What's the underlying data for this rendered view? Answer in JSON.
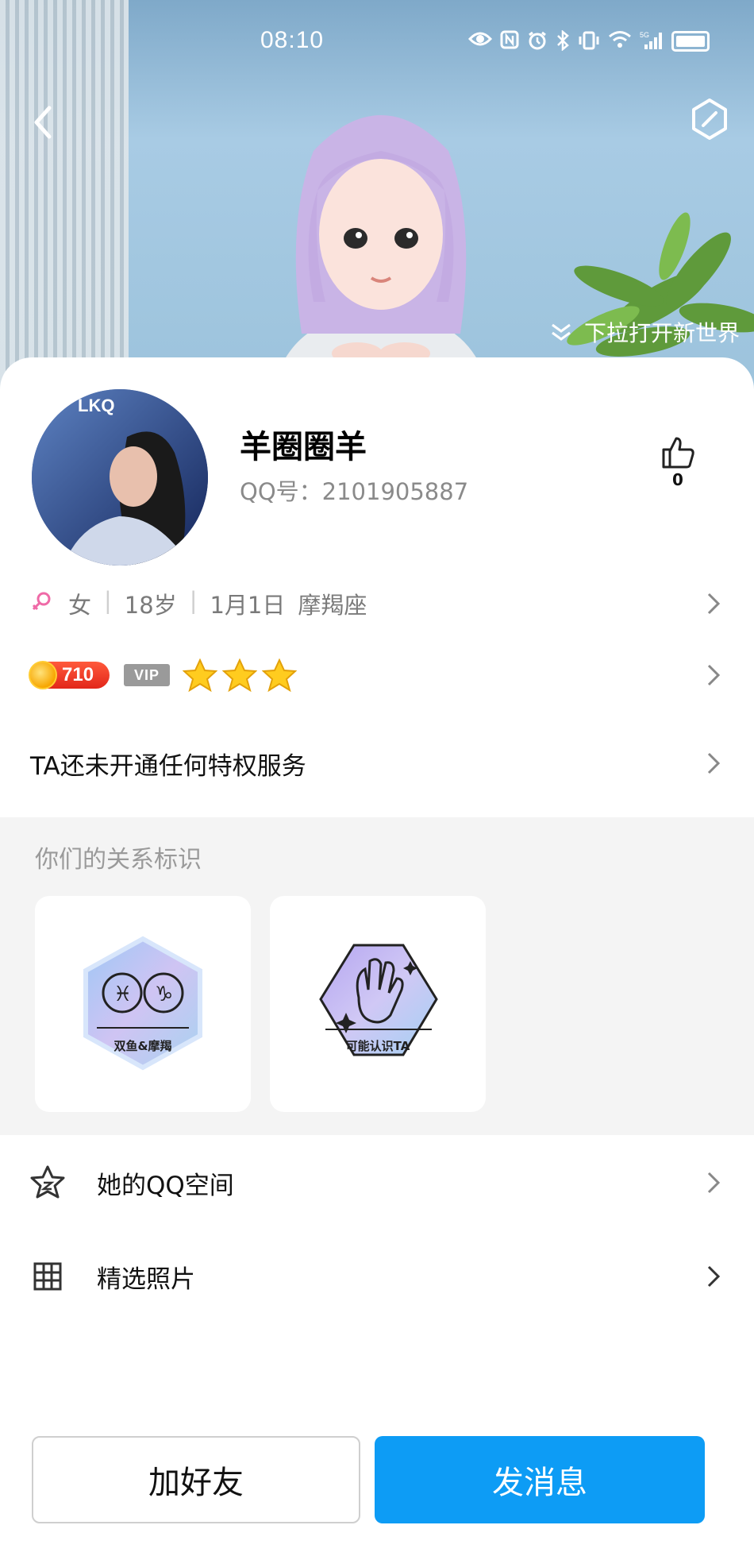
{
  "status_bar": {
    "time": "08:10",
    "icons": [
      "eye-icon",
      "nfc-icon",
      "alarm-icon",
      "bluetooth-icon",
      "vibrate-icon",
      "wifi-icon",
      "signal-5g-icon",
      "battery-icon"
    ]
  },
  "header": {
    "pull_hint": "下拉打开新世界",
    "back_icon": "back-arrow-icon",
    "menu_icon": "hexagon-menu-icon"
  },
  "profile": {
    "name": "羊圈圈羊",
    "qq_label": "QQ号：2101905887",
    "likes": "0",
    "gender": "女",
    "age": "18岁",
    "birthday": "1月1日",
    "zodiac": "摩羯座"
  },
  "badges": {
    "level": "710",
    "vip": "VIP",
    "star_count": 3
  },
  "privilege": "TA还未开通任何特权服务",
  "relation": {
    "title": "你们的关系标识",
    "cards": [
      {
        "label": "双鱼&摩羯"
      },
      {
        "label": "可能认识TA"
      }
    ]
  },
  "menu": [
    {
      "label": "她的QQ空间",
      "icon": "qzone-star-icon"
    },
    {
      "label": "精选照片",
      "icon": "grid-photos-icon"
    }
  ],
  "actions": {
    "add_friend": "加好友",
    "send_message": "发消息"
  },
  "colors": {
    "accent": "#0d9cf5",
    "banner": "#a8cbe4",
    "level_badge": "#e2261a"
  }
}
